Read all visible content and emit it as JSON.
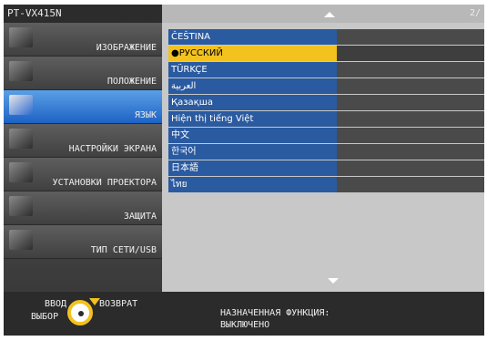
{
  "header": {
    "model": "PT-VX415N",
    "page_indicator": "2/"
  },
  "sidebar": {
    "items": [
      {
        "label": "ИЗОБРАЖЕНИЕ",
        "icon": "picture-icon",
        "active": false
      },
      {
        "label": "ПОЛОЖЕНИЕ",
        "icon": "position-icon",
        "active": false
      },
      {
        "label": "ЯЗЫК",
        "icon": "language-icon",
        "active": true
      },
      {
        "label": "НАСТРОЙКИ ЭКРАНА",
        "icon": "display-icon",
        "active": false
      },
      {
        "label": "УСТАНОВКИ ПРОЕКТОРА",
        "icon": "wrench-icon",
        "active": false
      },
      {
        "label": "ЗАЩИТА",
        "icon": "lock-icon",
        "active": false
      },
      {
        "label": "ТИП СЕТИ/USB",
        "icon": "network-icon",
        "active": false
      }
    ]
  },
  "languages": [
    {
      "label": "ČEŠTINA",
      "selected": false
    },
    {
      "label": "●РУССКИЙ",
      "selected": true
    },
    {
      "label": "TÜRKÇE",
      "selected": false
    },
    {
      "label": "العربية",
      "selected": false
    },
    {
      "label": "Қазақша",
      "selected": false
    },
    {
      "label": "Hiện thị tiếng Việt",
      "selected": false
    },
    {
      "label": "中文",
      "selected": false
    },
    {
      "label": "한국어",
      "selected": false
    },
    {
      "label": "日本語",
      "selected": false
    },
    {
      "label": "ไทย",
      "selected": false
    }
  ],
  "footer": {
    "enter": "ВВОД",
    "select": "ВЫБОР",
    "return": "ВОЗВРАТ",
    "assigned_function": "НАЗНАЧЕННАЯ ФУНКЦИЯ:",
    "assigned_value": "ВЫКЛЮЧЕНО"
  },
  "colors": {
    "active": "#1e62c4",
    "selected": "#f3c21f",
    "list_item": "#2a5aa0"
  }
}
